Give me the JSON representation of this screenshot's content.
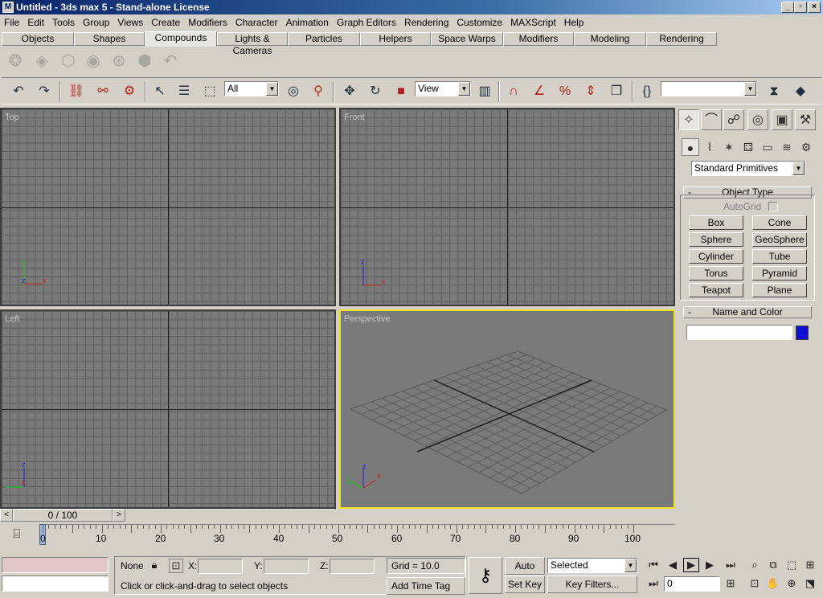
{
  "window": {
    "title": "Untitled - 3ds max 5 - Stand-alone License",
    "app_icon": "max-icon",
    "controls": [
      "minimize-icon",
      "restore-icon",
      "close-icon"
    ]
  },
  "menu": [
    "File",
    "Edit",
    "Tools",
    "Group",
    "Views",
    "Create",
    "Modifiers",
    "Character",
    "Animation",
    "Graph Editors",
    "Rendering",
    "Customize",
    "MAXScript",
    "Help"
  ],
  "tabs": [
    "Objects",
    "Shapes",
    "Compounds",
    "Lights & Cameras",
    "Particles",
    "Helpers",
    "Space Warps",
    "Modifiers",
    "Modeling",
    "Rendering"
  ],
  "active_tab": "Compounds",
  "toolbar": {
    "selection_filter": "All",
    "reference_coord": "View",
    "named_selection": ""
  },
  "viewports": {
    "top": "Top",
    "front": "Front",
    "left": "Left",
    "perspective": "Perspective"
  },
  "axes": {
    "x": "x",
    "y": "y",
    "z": "z"
  },
  "command_panel": {
    "category": "Standard Primitives",
    "object_type_title": "Object Type",
    "autogrid": "AutoGrid",
    "primitives": [
      "Box",
      "Cone",
      "Sphere",
      "GeoSphere",
      "Cylinder",
      "Tube",
      "Torus",
      "Pyramid",
      "Teapot",
      "Plane"
    ],
    "name_color_title": "Name and Color",
    "object_color": "#1010d0",
    "collapse_symbol": "-"
  },
  "timeline": {
    "frame_display": "0 / 100",
    "prev": "<",
    "next": ">",
    "ticks": [
      "0",
      "10",
      "20",
      "30",
      "40",
      "50",
      "60",
      "70",
      "80",
      "90",
      "100"
    ]
  },
  "status": {
    "selection": "None",
    "x_label": "X:",
    "y_label": "Y:",
    "z_label": "Z:",
    "grid": "Grid = 10.0",
    "prompt": "Click or click-and-drag to select objects",
    "add_time_tag": "Add Time Tag",
    "auto_key": "Auto Key",
    "set_key": "Set Key",
    "key_mode": "Selected",
    "key_filters": "Key Filters...",
    "current_frame": "0"
  }
}
